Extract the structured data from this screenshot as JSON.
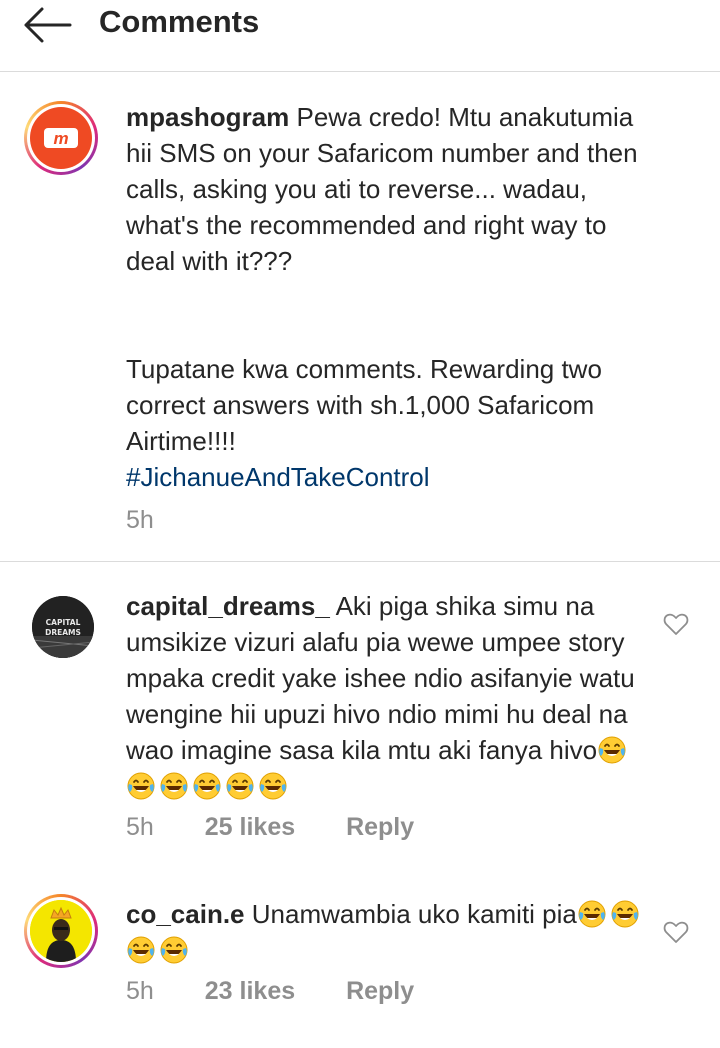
{
  "header": {
    "title": "Comments"
  },
  "caption": {
    "username": "mpashogram",
    "text_main": "Pewa credo! Mtu anakutumia hii SMS on your Safaricom number and then calls, asking you ati to reverse... wadau, what's the recommended and right way to deal with it???",
    "text_second": "Tupatane kwa comments. Rewarding two correct answers with sh.1,000 Safaricom Airtime!!!!",
    "hashtag": "#JichanueAndTakeControl",
    "time": "5h",
    "avatar_logo_text": "m"
  },
  "comments": [
    {
      "username": "capital_dreams_",
      "text": "Aki piga shika simu na umsikize vizuri alafu pia wewe umpee story mpaka credit yake ishee ndio asifanyie watu wengine hii upuzi hivo ndio mimi hu deal na wao imagine sasa kila mtu aki fanya hivo",
      "emoji_count": 6,
      "time": "5h",
      "likes": "25 likes",
      "reply": "Reply",
      "avatar_text_top": "CAPITAL",
      "avatar_text_bottom": "DREAMS"
    },
    {
      "username": "co_cain.e",
      "text": "Unamwambia uko kamiti pia",
      "emoji_count": 4,
      "time": "5h",
      "likes": "23 likes",
      "reply": "Reply"
    }
  ],
  "colors": {
    "text": "#262626",
    "muted": "#8e8e8e",
    "hashtag": "#00376b",
    "divider": "#dbdbdb",
    "brand_red": "#ef4a23"
  },
  "icons": [
    "arrow-left-icon",
    "heart-outline-icon",
    "face-with-tears-of-joy-emoji"
  ]
}
